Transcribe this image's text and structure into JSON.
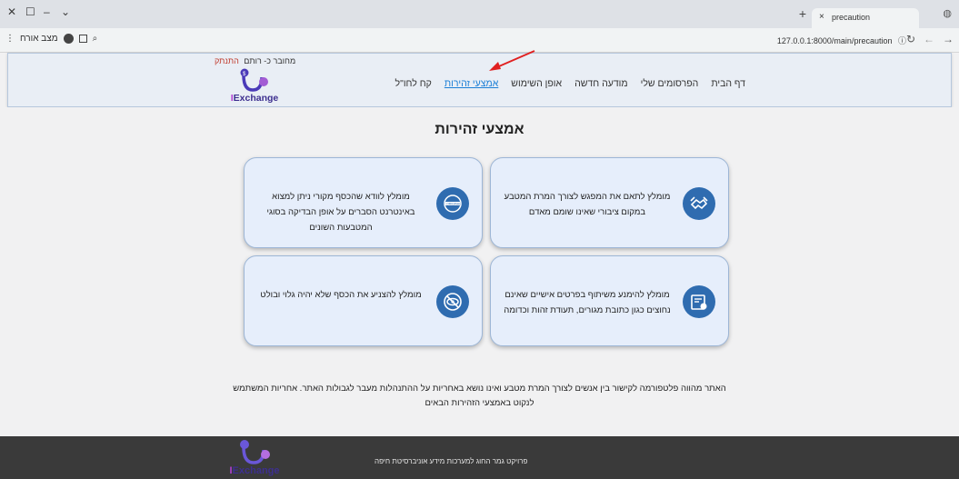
{
  "browser": {
    "tab_title": "precaution",
    "url": "127.0.0.1:8000/main/precaution",
    "profile_label": "מצב אורח",
    "new_tab_symbol": "+",
    "close_symbol": "×"
  },
  "header": {
    "user_prefix": "מחובר כ- רותם",
    "logout_label": "התנתק",
    "logo_text_main": "Exchange",
    "logo_text_prefix": "I",
    "nav": [
      {
        "label": "דף הבית",
        "active": false
      },
      {
        "label": "הפרסומים שלי",
        "active": false
      },
      {
        "label": "מודעה חדשה",
        "active": false
      },
      {
        "label": "אופן השימוש",
        "active": false
      },
      {
        "label": "אמצעי זהירות",
        "active": true
      },
      {
        "label": "קח לחו\"ל",
        "active": false
      }
    ]
  },
  "main": {
    "title": "אמצעי זהירות",
    "cards": [
      {
        "text": "מומלץ לתאם את המפגש לצורך המרת המטבע במקום ציבורי שאינו שומם מאדם",
        "icon": "handshake-icon"
      },
      {
        "text": "מומלץ לוודא שהכסף מקורי ניתן למצוא באינטרנט הסברים על אופן הבדיקה בסוגי המטבעות השונים",
        "icon": "original-stamp-icon"
      },
      {
        "text": "מומלץ להימנע משיתוף בפרטים אישיים שאינם נחוצים כגון כתובת מגורים, תעודת זהות וכדומה",
        "icon": "id-card-icon"
      },
      {
        "text": "מומלץ להצניע את הכסף שלא יהיה גלוי ובולט",
        "icon": "eye-off-icon"
      }
    ],
    "disclaimer_line1": "האתר מהווה פלטפורמה לקישור בין אנשים לצורך המרת מטבע ואינו נושא באחריות על ההתנהלות מעבר לגבולות האתר. אחריות המשתמש",
    "disclaimer_line2": "לנקוט באמצעי הזהירות הבאים"
  },
  "footer": {
    "text": "פרויקט גמר החוג למערכות מידע אוניברסיטת חיפה"
  },
  "colors": {
    "accent": "#1b7fd6",
    "card_bg": "#e6eefb",
    "icon_bg": "#2f6cb0",
    "footer_bg": "#3a3a3a",
    "arrow": "#e02020"
  }
}
